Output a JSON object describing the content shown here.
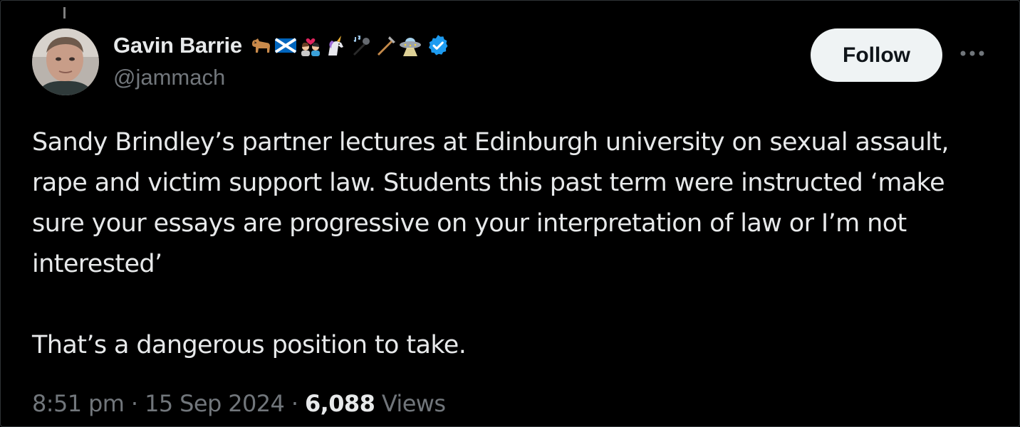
{
  "tweet": {
    "author": {
      "display_name": "Gavin Barrie",
      "handle": "@jammach",
      "name_emojis": [
        "dog-emoji",
        "scotland-flag-emoji",
        "couple-with-heart-emoji",
        "unicorn-emoji",
        "microphone-emoji",
        "crutch-emoji",
        "ufo-emoji"
      ],
      "verified": true
    },
    "follow_label": "Follow",
    "text_paragraphs": [
      "Sandy Brindley’s partner lectures at Edinburgh university on sexual assault, rape and victim support law. Students this past term were instructed ‘make sure your essays are progressive on your interpretation of law or I’m not interested’",
      "That’s a dangerous position to take."
    ],
    "time": "8:51 pm",
    "separator": "·",
    "date": "15 Sep 2024",
    "views_count": "6,088",
    "views_label": "Views"
  },
  "colors": {
    "background": "#000000",
    "text_primary": "#e7e9ea",
    "text_secondary": "#71767b",
    "verified_blue": "#1d9bf0",
    "follow_bg": "#eff3f4"
  }
}
